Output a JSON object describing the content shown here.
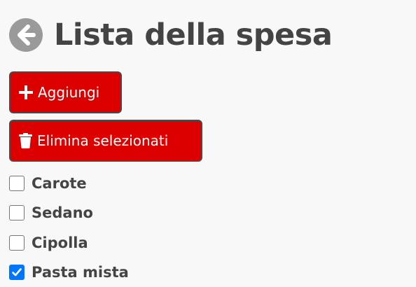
{
  "header": {
    "title": "Lista della spesa",
    "back_icon": "arrow-left-circle-icon"
  },
  "toolbar": {
    "add_label": "Aggiungi",
    "add_icon": "plus-icon",
    "delete_label": "Elimina selezionati",
    "delete_icon": "trash-icon"
  },
  "items": [
    {
      "label": "Carote",
      "checked": false
    },
    {
      "label": "Sedano",
      "checked": false
    },
    {
      "label": "Cipolla",
      "checked": false
    },
    {
      "label": "Pasta mista",
      "checked": true
    }
  ],
  "colors": {
    "button_bg": "#dd0000",
    "background": "#f8f8f8",
    "text": "#444444",
    "checkbox_checked": "#0075ff",
    "back_icon": "#9a9a9a"
  }
}
